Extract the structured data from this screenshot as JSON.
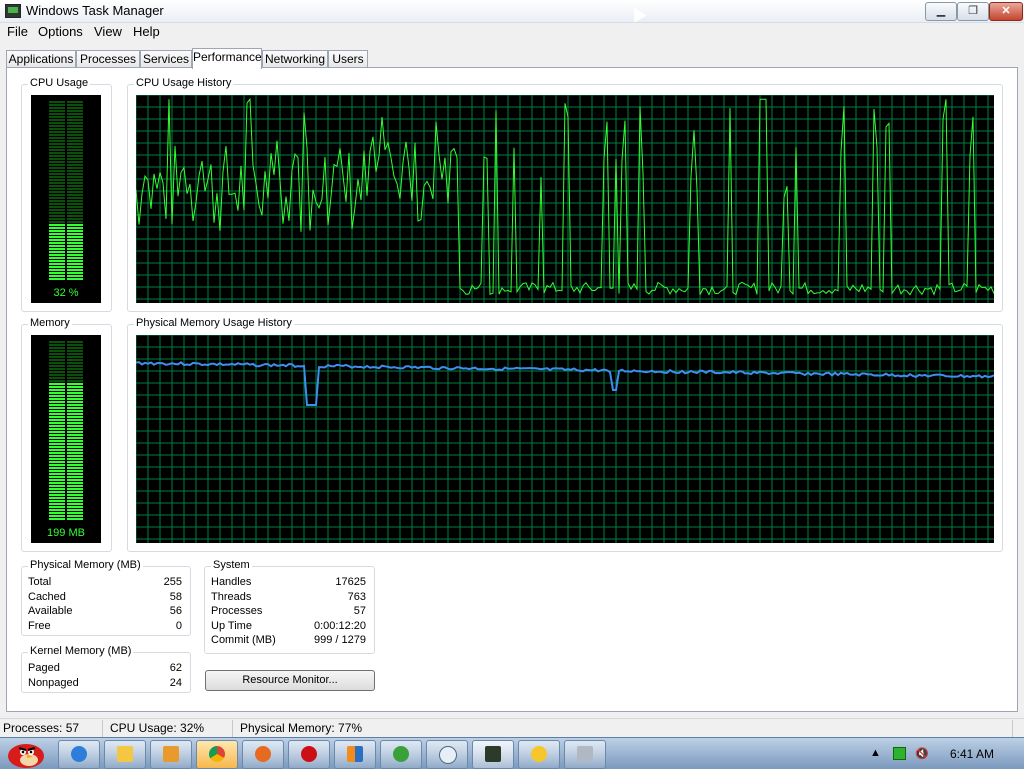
{
  "window": {
    "title": "Windows Task Manager"
  },
  "menu": [
    "File",
    "Options",
    "View",
    "Help"
  ],
  "tabs": [
    "Applications",
    "Processes",
    "Services",
    "Performance",
    "Networking",
    "Users"
  ],
  "active_tab": "Performance",
  "cpu_usage": {
    "label": "CPU Usage",
    "value_text": "32 %",
    "value": 32
  },
  "cpu_history": {
    "label": "CPU Usage History"
  },
  "memory": {
    "label": "Memory",
    "value_text": "199 MB",
    "fraction": 0.77
  },
  "memory_history": {
    "label": "Physical Memory Usage History"
  },
  "physical_memory": {
    "label": "Physical Memory (MB)",
    "rows": [
      {
        "name": "Total",
        "value": "255"
      },
      {
        "name": "Cached",
        "value": "58"
      },
      {
        "name": "Available",
        "value": "56"
      },
      {
        "name": "Free",
        "value": "0"
      }
    ]
  },
  "kernel_memory": {
    "label": "Kernel Memory (MB)",
    "rows": [
      {
        "name": "Paged",
        "value": "62"
      },
      {
        "name": "Nonpaged",
        "value": "24"
      }
    ]
  },
  "system": {
    "label": "System",
    "rows": [
      {
        "name": "Handles",
        "value": "17625"
      },
      {
        "name": "Threads",
        "value": "763"
      },
      {
        "name": "Processes",
        "value": "57"
      },
      {
        "name": "Up Time",
        "value": "0:00:12:20"
      },
      {
        "name": "Commit (MB)",
        "value": "999 / 1279"
      }
    ]
  },
  "resource_monitor_button": "Resource Monitor...",
  "status": {
    "processes": "Processes: 57",
    "cpu": "CPU Usage: 32%",
    "memory": "Physical Memory: 77%"
  },
  "taskbar": {
    "items": [
      "explorer-icon",
      "folder-icon",
      "media-player-icon",
      "chrome-icon",
      "firefox-icon",
      "opera-icon",
      "app-icon",
      "utorrent-icon",
      "chat-icon",
      "task-manager-icon",
      "messenger-icon",
      "tool-icon"
    ],
    "clock": "6:41 AM"
  },
  "colors": {
    "graph_bg": "#000000",
    "grid": "#008040",
    "cpu_line": "#33ff33",
    "memory_line": "#3e8ef0",
    "close_button": "#c5452f"
  }
}
